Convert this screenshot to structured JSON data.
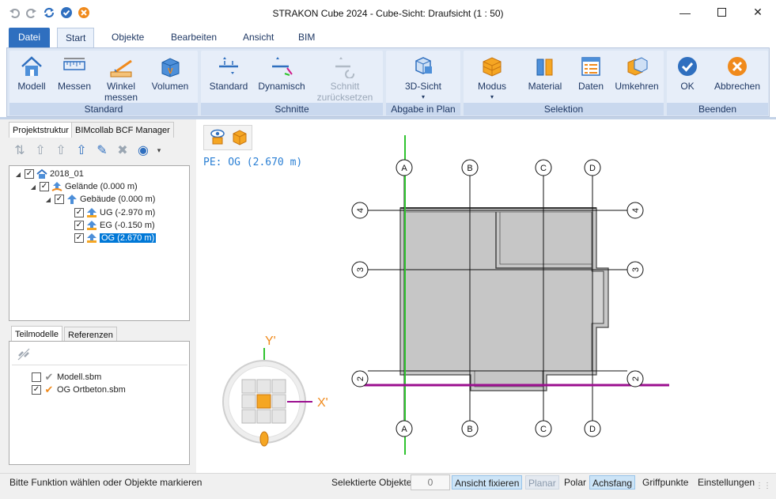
{
  "window": {
    "title": "STRAKON Cube 2024 - Cube-Sicht: Draufsicht (1 : 50)",
    "minimize_icon": "minimize-icon",
    "maximize_icon": "maximize-icon",
    "close_icon": "close-icon"
  },
  "quick_access": [
    "undo-icon",
    "redo-icon",
    "refresh-icon",
    "ok-check-icon",
    "cancel-x-icon"
  ],
  "tabs": {
    "file": "Datei",
    "items": [
      "Start",
      "Objekte",
      "Bearbeiten",
      "Ansicht",
      "BIM"
    ],
    "active": "Start"
  },
  "ribbon": {
    "standard": {
      "label": "Standard",
      "modell": "Modell",
      "messen": "Messen",
      "winkel_1": "Winkel",
      "winkel_2": "messen",
      "volumen": "Volumen"
    },
    "schnitte": {
      "label": "Schnitte",
      "standard": "Standard",
      "dynamisch": "Dynamisch",
      "reset_1": "Schnitt",
      "reset_2": "zurücksetzen"
    },
    "abgabe": {
      "label": "Abgabe in Plan",
      "view3d": "3D-Sicht"
    },
    "selektion": {
      "label": "Selektion",
      "modus": "Modus",
      "material": "Material",
      "daten": "Daten",
      "umkehren": "Umkehren"
    },
    "beenden": {
      "label": "Beenden",
      "ok": "OK",
      "abbrechen": "Abbrechen"
    }
  },
  "left_panel": {
    "tabs": [
      "Projektstruktur",
      "BIMcollab BCF Manager"
    ],
    "tree": {
      "root": "2018_01",
      "gelaende": "Gelände (0.000 m)",
      "gebaeude": "Gebäude (0.000 m)",
      "ug": "UG (-2.970 m)",
      "eg": "EG (-0.150 m)",
      "og": "OG (2.670 m)"
    },
    "sub_tabs": [
      "Teilmodelle",
      "Referenzen"
    ],
    "sub_models": [
      "Modell.sbm",
      "OG Ortbeton.sbm"
    ]
  },
  "viewport": {
    "pe_label": "PE: OG (2.670 m)",
    "axes_top": [
      "A",
      "B",
      "C",
      "D"
    ],
    "axes_side": [
      "4",
      "3",
      "2"
    ],
    "axis_y": "Y'",
    "axis_x": "X'"
  },
  "status": {
    "message": "Bitte Funktion wählen oder Objekte markieren",
    "selected_label": "Selektierte Objekte",
    "selected_count": "0",
    "ansicht_fixieren": "Ansicht fixieren",
    "planar": "Planar",
    "polar": "Polar",
    "achsfang": "Achsfang",
    "griffpunkte": "Griffpunkte",
    "einstellungen": "Einstellungen"
  },
  "colors": {
    "accent": "#2f6fbf",
    "ribbon_bg": "#dce6f4",
    "axis_green": "#2fc32f",
    "axis_magenta": "#9b0f8f",
    "slab_gray": "#c8c8c8",
    "highlight_orange": "#f0a030"
  }
}
